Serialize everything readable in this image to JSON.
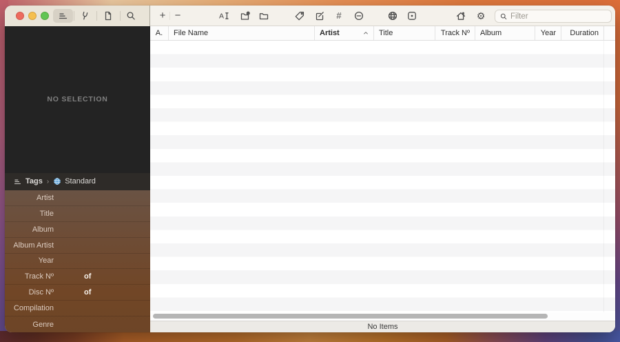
{
  "titlebar": {
    "traffic_lights": [
      "close",
      "minimize",
      "zoom"
    ],
    "segments": [
      "editor-pane",
      "tuning-fork",
      "document",
      "search"
    ],
    "tools": {
      "add_glyph": "+",
      "remove_glyph": "−",
      "hash_glyph": "#",
      "gear_glyph": "⚙"
    },
    "filter": {
      "placeholder": "Filter"
    }
  },
  "sidebar": {
    "no_selection": "NO SELECTION",
    "breadcrumb": {
      "root": "Tags",
      "chevron": "›",
      "current": "Standard"
    },
    "form": {
      "fields": [
        {
          "label": "Artist"
        },
        {
          "label": "Title"
        },
        {
          "label": "Album"
        },
        {
          "label": "Album Artist"
        },
        {
          "label": "Year"
        },
        {
          "label": "Track Nº",
          "suffix": "of"
        },
        {
          "label": "Disc Nº",
          "suffix": "of"
        },
        {
          "label": "Compilation"
        },
        {
          "label": "Genre"
        }
      ]
    }
  },
  "table": {
    "columns": [
      {
        "label": "A."
      },
      {
        "label": "File Name"
      },
      {
        "label": "Artist",
        "sorted": "asc"
      },
      {
        "label": "Title"
      },
      {
        "label": "Track Nº"
      },
      {
        "label": "Album"
      },
      {
        "label": "Year"
      },
      {
        "label": "Duration"
      },
      {
        "label": ""
      }
    ],
    "status": "No Items"
  },
  "colors": {
    "traffic_red": "#ed6a5e",
    "traffic_yellow": "#f5bf4f",
    "traffic_green": "#62c554",
    "breadcrumb_globe_blue": "#63a5d8",
    "sidebar_panel_dark": "#232323",
    "sidebar_form_brown": "#6e4b31",
    "row_stripe_gray": "#f5f5f6",
    "titlebar_left": "#e9e4d8",
    "titlebar_right": "#f4f1eb"
  }
}
